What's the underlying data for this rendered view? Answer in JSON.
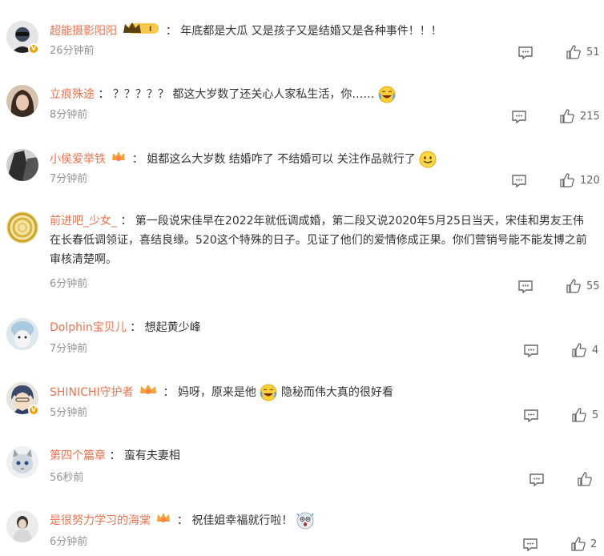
{
  "comments": [
    {
      "user": "超能摄影阳阳",
      "sep": "：",
      "text": "年底都是大瓜 又是孩子又是结婚又是各种事件！！！",
      "time": "26分钟前",
      "likes": "51",
      "badge": "crown-level-1",
      "badge_label": "I",
      "verified": true,
      "avatar_color": "#3d4a5c"
    },
    {
      "user": "立痕殊途",
      "sep": "：",
      "text": "？？？？？ 都这大岁数了还关心人家私生活，你……",
      "emoji": "laugh-cry-emoji",
      "time": "8分钟前",
      "likes": "215",
      "avatar_color": "#4b3b34"
    },
    {
      "user": "小侯爱举铁",
      "sep": "：",
      "text": "姐都这么大岁数 结婚咋了 不结婚可以 关注作品就行了",
      "emoji": "smile-emoji",
      "badge": "crown-fan-badge",
      "time": "7分钟前",
      "likes": "120",
      "avatar_color": "#2e2e2e"
    },
    {
      "user": "前进吧_少女_",
      "sep": "：",
      "text": "第一段说宋佳早在2022年就低调成婚，第二段又说2020年5月25日当天，宋佳和男友王伟在长春低调领证，喜结良缘。520这个特殊的日子。见证了他们的爱情修成正果。你们营销号能不能发博之前审核清楚啊。",
      "time": "6分钟前",
      "likes": "55",
      "avatar_color": "#c9a22b"
    },
    {
      "user": "Dolphin宝贝儿",
      "sep": "：",
      "text": "想起黄少峰",
      "time": "7分钟前",
      "likes": "4",
      "avatar_color": "#a9c9e0"
    },
    {
      "user": "SHINICHI守护者",
      "sep": "：",
      "text_before": "妈呀，原来是他",
      "emoji": "laugh-cry-emoji",
      "text": "隐秘而伟大真的很好看",
      "badge": "crown-fan-badge",
      "verified": true,
      "time": "5分钟前",
      "likes": "5",
      "avatar_color": "#3a4a6b"
    },
    {
      "user": "第四个篇章",
      "sep": "：",
      "text": "蛮有夫妻相",
      "time": "56秒前",
      "likes": "",
      "avatar_color": "#cfd6de"
    },
    {
      "user": "是很努力学习的海棠",
      "sep": "：",
      "text": "祝佳姐幸福就行啦！",
      "emoji": "shocked-emoji",
      "badge": "crown-fan-badge",
      "time": "6分钟前",
      "likes": "2",
      "avatar_color": "#d8d8d8"
    }
  ],
  "colors": {
    "username": "#eb7350",
    "meta": "#939393",
    "text": "#333333",
    "badge_gold": "#f0a000"
  }
}
